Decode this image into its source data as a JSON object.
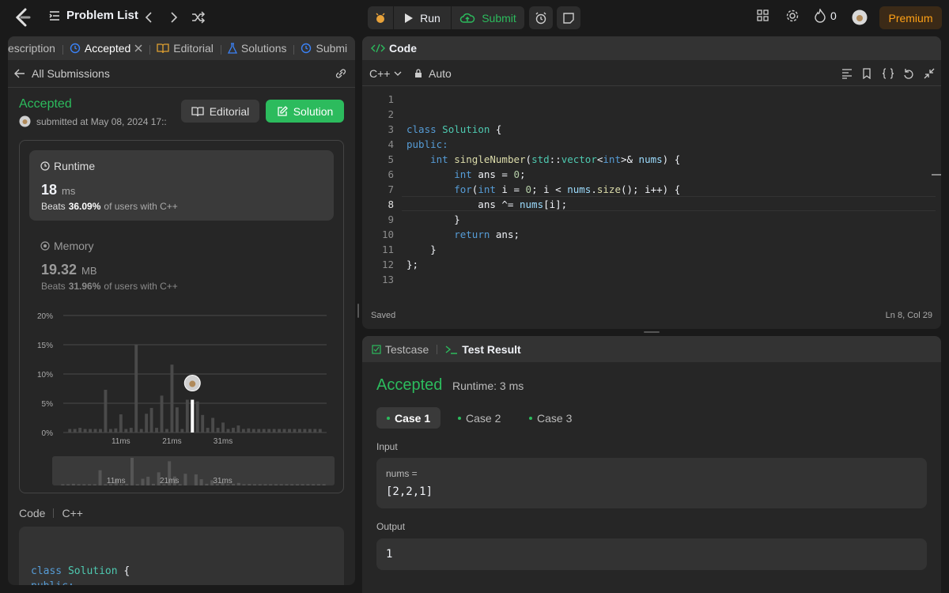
{
  "topbar": {
    "problem_list": "Problem List",
    "run": "Run",
    "submit": "Submit",
    "streak": "0",
    "premium": "Premium",
    "accent": "#ffa116"
  },
  "left": {
    "tabs": [
      "escription",
      "Accepted",
      "Editorial",
      "Solutions",
      "Submi"
    ],
    "all_submissions": "All Submissions",
    "status": "Accepted",
    "submitted": "submitted at May 08, 2024 17::",
    "editorial_btn": "Editorial",
    "solution_btn": "Solution",
    "runtime": {
      "title": "Runtime",
      "value": "18",
      "unit": "ms",
      "beats_pre": "Beats",
      "beats_pct": "36.09%",
      "beats_post": "of users with C++"
    },
    "memory": {
      "title": "Memory",
      "value": "19.32",
      "unit": "MB",
      "beats_pre": "Beats",
      "beats_pct": "31.96%",
      "beats_post": "of users with C++"
    },
    "code_label": "Code",
    "code_lang": "C++",
    "code_preview": [
      "class Solution {",
      "public:"
    ]
  },
  "chart_data": {
    "type": "bar",
    "ylabels": [
      "20%",
      "15%",
      "10%",
      "5%",
      "0%"
    ],
    "ylim": [
      0,
      20
    ],
    "xlabels": [
      "11ms",
      "21ms",
      "31ms"
    ],
    "values": [
      0.6,
      0.6,
      0.8,
      0.6,
      0.6,
      0.6,
      0.6,
      7.3,
      0.6,
      0.7,
      3.1,
      0.6,
      0.8,
      15.0,
      0.6,
      3.2,
      4.2,
      0.8,
      6.3,
      0.6,
      11.6,
      4.3,
      0.6,
      5.6,
      0,
      5.3,
      3.0,
      0.8,
      2.5,
      0.8,
      1.7,
      0.6,
      0.8,
      1.2,
      0.6,
      0.7,
      0.6,
      0.6,
      0.6,
      0.6,
      0.6,
      0.6,
      0.6,
      0.6,
      0.6,
      0.6,
      0.6,
      0.6,
      0.6,
      0.6
    ],
    "highlight_index": 24,
    "highlight_value": 5.6
  },
  "editor": {
    "header": "Code",
    "lang": "C++",
    "mode": "Auto",
    "saved": "Saved",
    "cursor": "Ln 8, Col 29",
    "line_numbers": [
      "1",
      "2",
      "3",
      "4",
      "5",
      "6",
      "7",
      "8",
      "9",
      "10",
      "11",
      "12",
      "13"
    ]
  },
  "result": {
    "tab_testcase": "Testcase",
    "tab_result": "Test Result",
    "status": "Accepted",
    "runtime": "Runtime: 3 ms",
    "cases": [
      "Case 1",
      "Case 2",
      "Case 3"
    ],
    "input_label": "Input",
    "input_name": "nums =",
    "input_value": "[2,2,1]",
    "output_label": "Output",
    "output_value": "1"
  }
}
